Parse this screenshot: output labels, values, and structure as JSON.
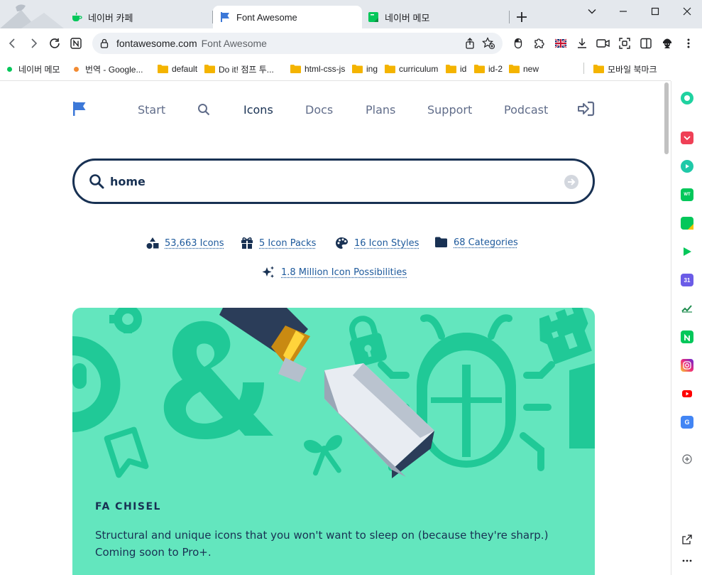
{
  "browser": {
    "tabs": [
      {
        "title": "네이버 카페",
        "icon": "naver-cafe-icon",
        "active": false
      },
      {
        "title": "Font Awesome",
        "icon": "font-awesome-flag-icon",
        "active": true
      },
      {
        "title": "네이버 메모",
        "icon": "naver-memo-icon",
        "active": false
      }
    ],
    "address": {
      "host": "fontawesome.com",
      "title": "Font Awesome"
    },
    "bookmarks": [
      {
        "label": "네이버 메모",
        "type": "site",
        "color": "#03c75a"
      },
      {
        "label": "번역 - Google...",
        "type": "site",
        "color": "#f28b33"
      },
      {
        "label": "default",
        "type": "folder"
      },
      {
        "label": "Do it! 점프 투...",
        "type": "folder"
      },
      {
        "label": "html-css-js",
        "type": "folder"
      },
      {
        "label": "ing",
        "type": "folder"
      },
      {
        "label": "curriculum",
        "type": "folder"
      },
      {
        "label": "id",
        "type": "folder"
      },
      {
        "label": "id-2",
        "type": "folder"
      },
      {
        "label": "new",
        "type": "folder"
      },
      {
        "label": "모바일 북마크",
        "type": "folder"
      }
    ]
  },
  "site": {
    "nav": {
      "start": "Start",
      "icons": "Icons",
      "docs": "Docs",
      "plans": "Plans",
      "support": "Support",
      "podcast": "Podcast"
    },
    "search": {
      "query": "home"
    },
    "stats": {
      "icons": "53,663 Icons",
      "packs": "5 Icon Packs",
      "styles": "16 Icon Styles",
      "categories": "68 Categories",
      "possibilities": "1.8 Million Icon Possibilities"
    },
    "promo": {
      "title": "FA CHISEL",
      "description": "Structural and unique icons that you won't want to sleep on (because they're sharp.) Coming soon to Pro+."
    }
  },
  "colors": {
    "navy": "#183153",
    "promo_bg": "#63e6be",
    "promo_shape": "#20c997",
    "link": "#1e5a9c",
    "fa_blue": "#3c78d8"
  }
}
